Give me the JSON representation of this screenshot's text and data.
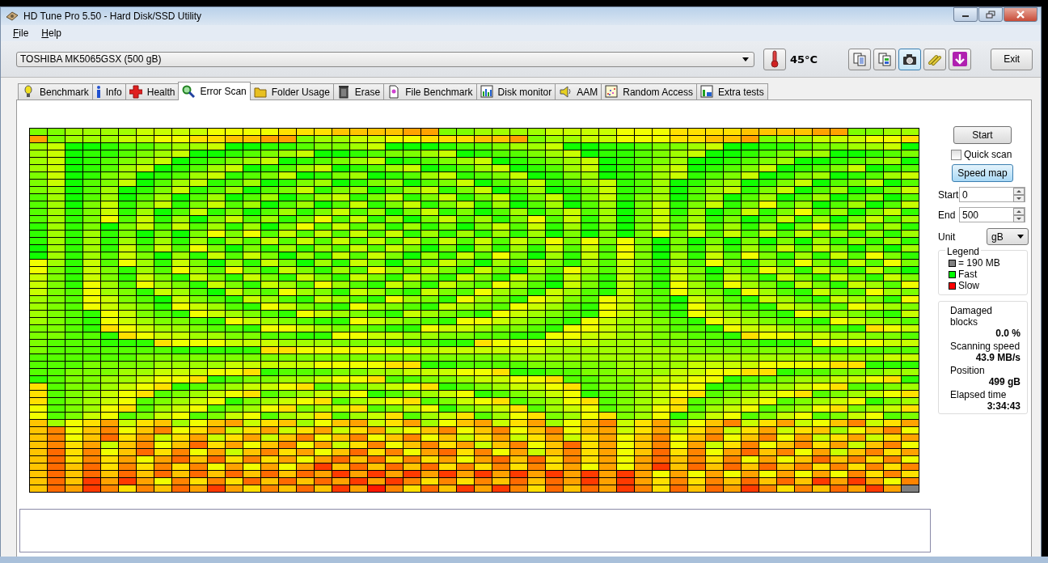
{
  "window": {
    "title": "HD Tune Pro 5.50 - Hard Disk/SSD Utility"
  },
  "menu": [
    {
      "label": "File"
    },
    {
      "label": "Help"
    }
  ],
  "drive": {
    "value": "TOSHIBA MK5065GSX (500 gB)"
  },
  "temperature": "45°C",
  "toolbar": [
    {
      "kind": "copy",
      "selected": false
    },
    {
      "kind": "copy-color",
      "selected": false
    },
    {
      "kind": "camera",
      "selected": true
    },
    {
      "kind": "tools",
      "selected": false
    },
    {
      "kind": "download",
      "selected": false
    }
  ],
  "exit_button": "Exit",
  "tabs": [
    {
      "label": "Benchmark",
      "kind": "bulb",
      "selected": false
    },
    {
      "label": "Info",
      "kind": "info",
      "selected": false
    },
    {
      "label": "Health",
      "kind": "cross",
      "selected": false
    },
    {
      "label": "Error Scan",
      "kind": "magnifier",
      "selected": true
    },
    {
      "label": "Folder Usage",
      "kind": "folder",
      "selected": false
    },
    {
      "label": "Erase",
      "kind": "bin",
      "selected": false
    },
    {
      "label": "File Benchmark",
      "kind": "file",
      "selected": false
    },
    {
      "label": "Disk monitor",
      "kind": "bars",
      "selected": false
    },
    {
      "label": "AAM",
      "kind": "speaker",
      "selected": false
    },
    {
      "label": "Random Access",
      "kind": "dots",
      "selected": false
    },
    {
      "label": "Extra tests",
      "kind": "grid",
      "selected": false
    }
  ],
  "controls": {
    "start_button": "Start",
    "quick_scan": {
      "label": "Quick scan",
      "checked": false
    },
    "speed_map": {
      "label": "Speed map",
      "selected": true
    },
    "start": {
      "label": "Start",
      "value": "0"
    },
    "end": {
      "label": "End",
      "value": "500"
    },
    "unit": {
      "label": "Unit",
      "value": "gB"
    }
  },
  "legend": {
    "title": "Legend",
    "items": [
      {
        "label": "= 190 MB",
        "color": "#808080"
      },
      {
        "label": "Fast",
        "color": "#00ff00"
      },
      {
        "label": "Slow",
        "color": "#ff0000"
      }
    ]
  },
  "stats": [
    {
      "label": "Damaged blocks",
      "value": "0.0 %"
    },
    {
      "label": "Scanning speed",
      "value": "43.9 MB/s"
    },
    {
      "label": "Position",
      "value": "499 gB"
    },
    {
      "label": "Elapsed time",
      "value": "3:34:43"
    }
  ]
}
